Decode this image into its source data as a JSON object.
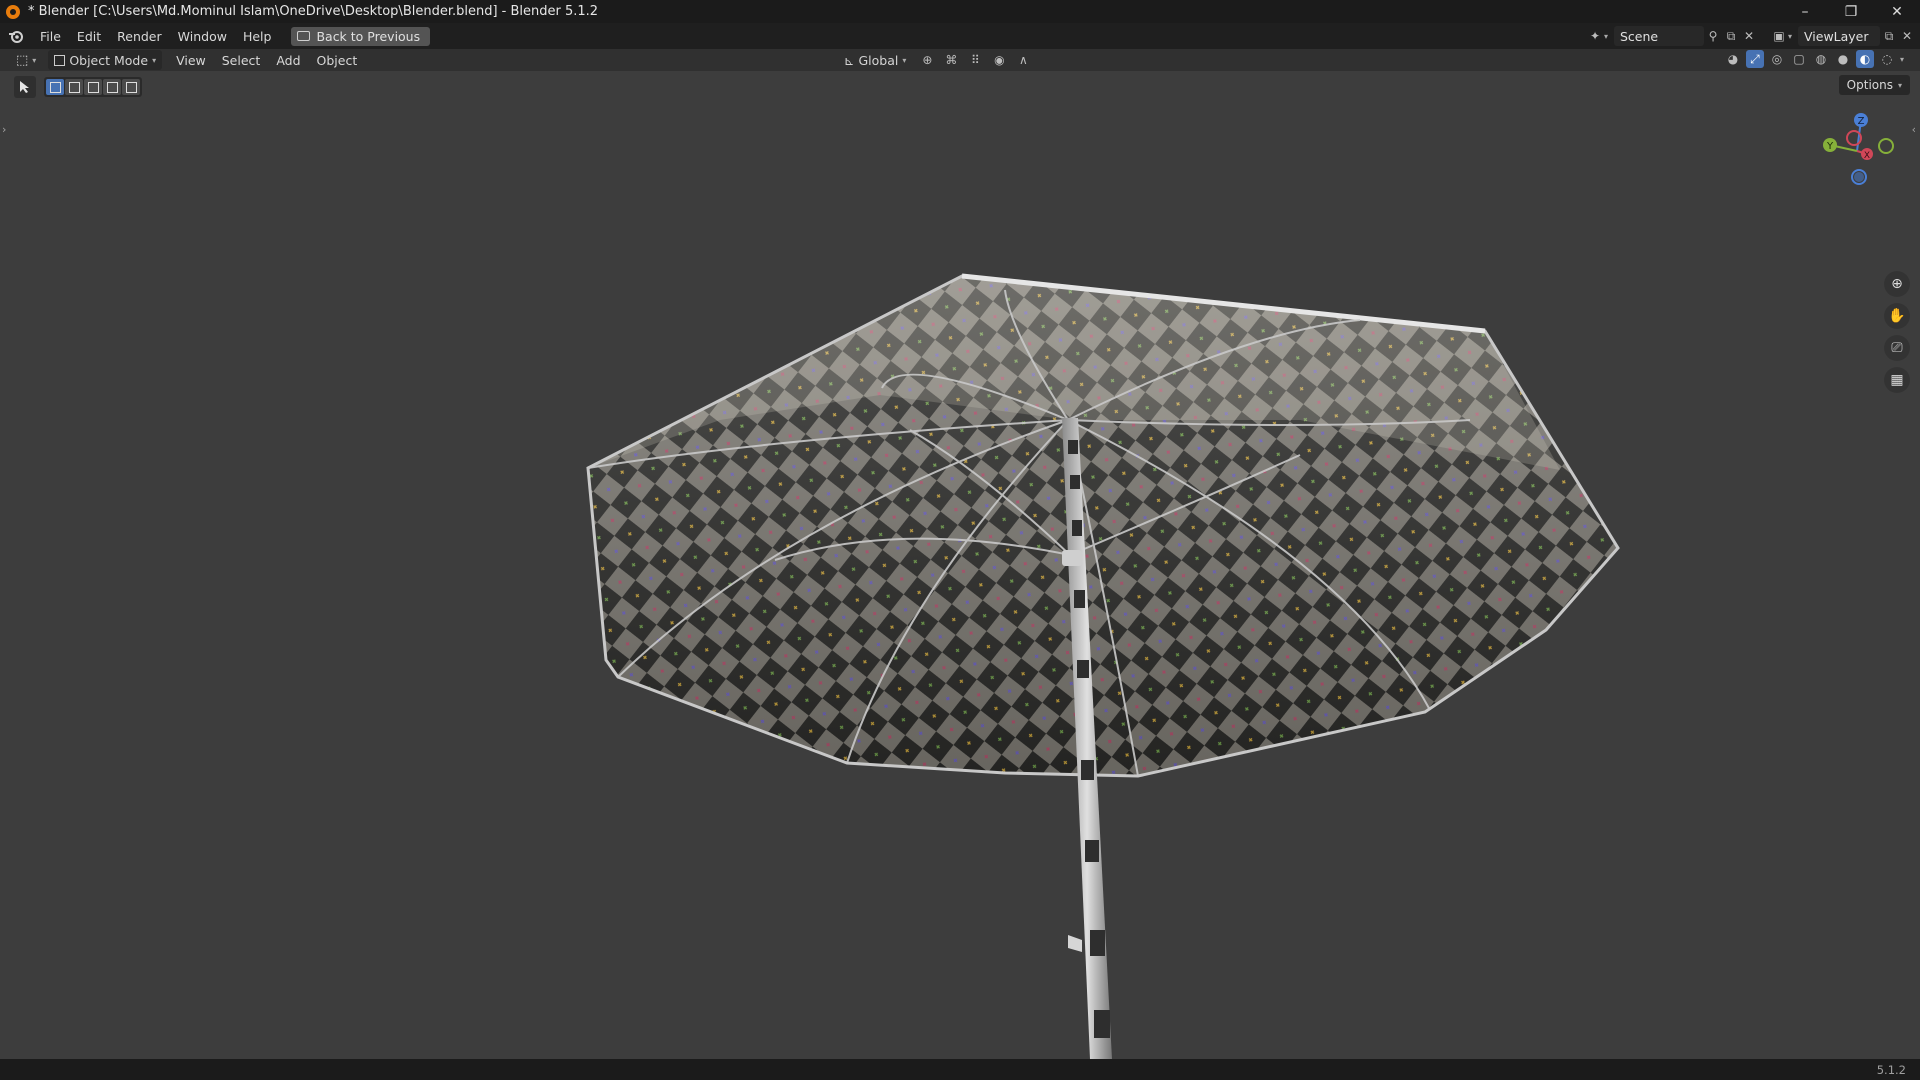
{
  "window": {
    "title": "* Blender [C:\\Users\\Md.Mominul Islam\\OneDrive\\Desktop\\Blender.blend] - Blender 5.1.2",
    "controls": [
      "–",
      "❐",
      "✕"
    ]
  },
  "menu": {
    "items": [
      "File",
      "Edit",
      "Render",
      "Window",
      "Help"
    ],
    "back_button": "Back to Previous"
  },
  "scene": {
    "scene_name": "Scene",
    "view_layer": "ViewLayer"
  },
  "header": {
    "mode": "Object Mode",
    "menus": [
      "View",
      "Select",
      "Add",
      "Object"
    ],
    "orientation": "Global"
  },
  "toolbar": {
    "options_label": "Options"
  },
  "gizmo": {
    "z": "Z",
    "y": "Y",
    "x": "X"
  },
  "status": {
    "version": "5.1.2"
  }
}
